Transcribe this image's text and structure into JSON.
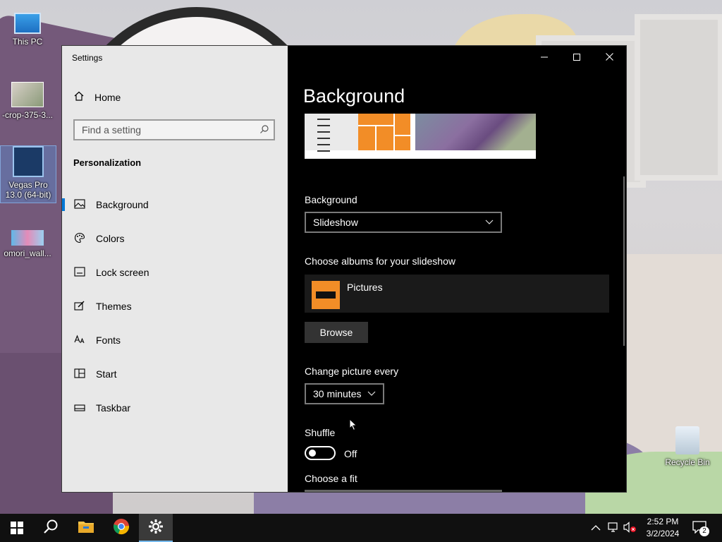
{
  "desktop": {
    "icons": [
      {
        "label": "This PC"
      },
      {
        "label": "-crop-375-3..."
      },
      {
        "label": "Vegas Pro 13.0 (64-bit)"
      },
      {
        "label": "omori_wall..."
      },
      {
        "label": "Recycle Bin"
      }
    ]
  },
  "window": {
    "title": "Settings",
    "caption_icons": [
      "minimize-icon",
      "maximize-icon",
      "close-icon"
    ]
  },
  "nav": {
    "home": "Home",
    "search_placeholder": "Find a setting",
    "section": "Personalization",
    "active": "Background",
    "items": [
      {
        "label": "Background",
        "icon": "picture-icon"
      },
      {
        "label": "Colors",
        "icon": "palette-icon"
      },
      {
        "label": "Lock screen",
        "icon": "lock-screen-icon"
      },
      {
        "label": "Themes",
        "icon": "themes-icon"
      },
      {
        "label": "Fonts",
        "icon": "fonts-icon"
      },
      {
        "label": "Start",
        "icon": "start-icon"
      },
      {
        "label": "Taskbar",
        "icon": "taskbar-icon"
      }
    ]
  },
  "content": {
    "title": "Background",
    "background_label": "Background",
    "background_value": "Slideshow",
    "albums_label": "Choose albums for your slideshow",
    "album_name": "Pictures",
    "browse_label": "Browse",
    "interval_label": "Change picture every",
    "interval_value": "30 minutes",
    "shuffle_label": "Shuffle",
    "shuffle_state": "Off",
    "fit_label": "Choose a fit"
  },
  "taskbar": {
    "apps": [
      "start-icon",
      "search-icon",
      "file-explorer-icon",
      "chrome-icon",
      "settings-icon"
    ],
    "active_app": "settings-icon",
    "time": "2:52 PM",
    "date": "3/2/2024",
    "notification_count": "2"
  }
}
